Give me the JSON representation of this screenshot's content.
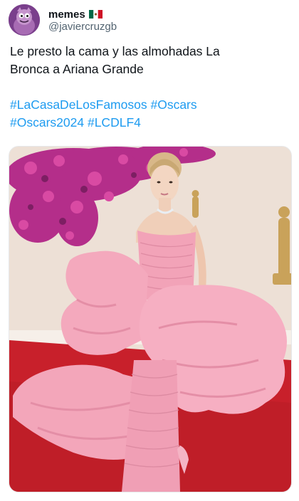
{
  "tweet": {
    "author_name": "memes",
    "author_flag": "mexico-flag-icon",
    "author_handle": "@javiercruzgb",
    "text_lines": [
      "Le presto la cama y las almohadas La",
      "Bronca a Ariana Grande"
    ],
    "hashtag_lines": [
      [
        "#LaCasaDeLosFamosos",
        "#Oscars"
      ],
      [
        "#Oscars2024",
        "#LCDLF4"
      ]
    ]
  },
  "media": {
    "image": "photo-of-woman-in-voluminous-pink-gown-at-oscars-red-carpet",
    "colors": {
      "carpet": "#c8202b",
      "wall": "#f1e6de",
      "flowers": "#b42e8a",
      "gown": "#f4a9bd",
      "gown_shadow": "#e48ea6"
    }
  },
  "colors": {
    "accent": "#1d9bf0",
    "text": "#0f1419",
    "secondary": "#536471",
    "avatar_bg": "#7a3f8c"
  }
}
